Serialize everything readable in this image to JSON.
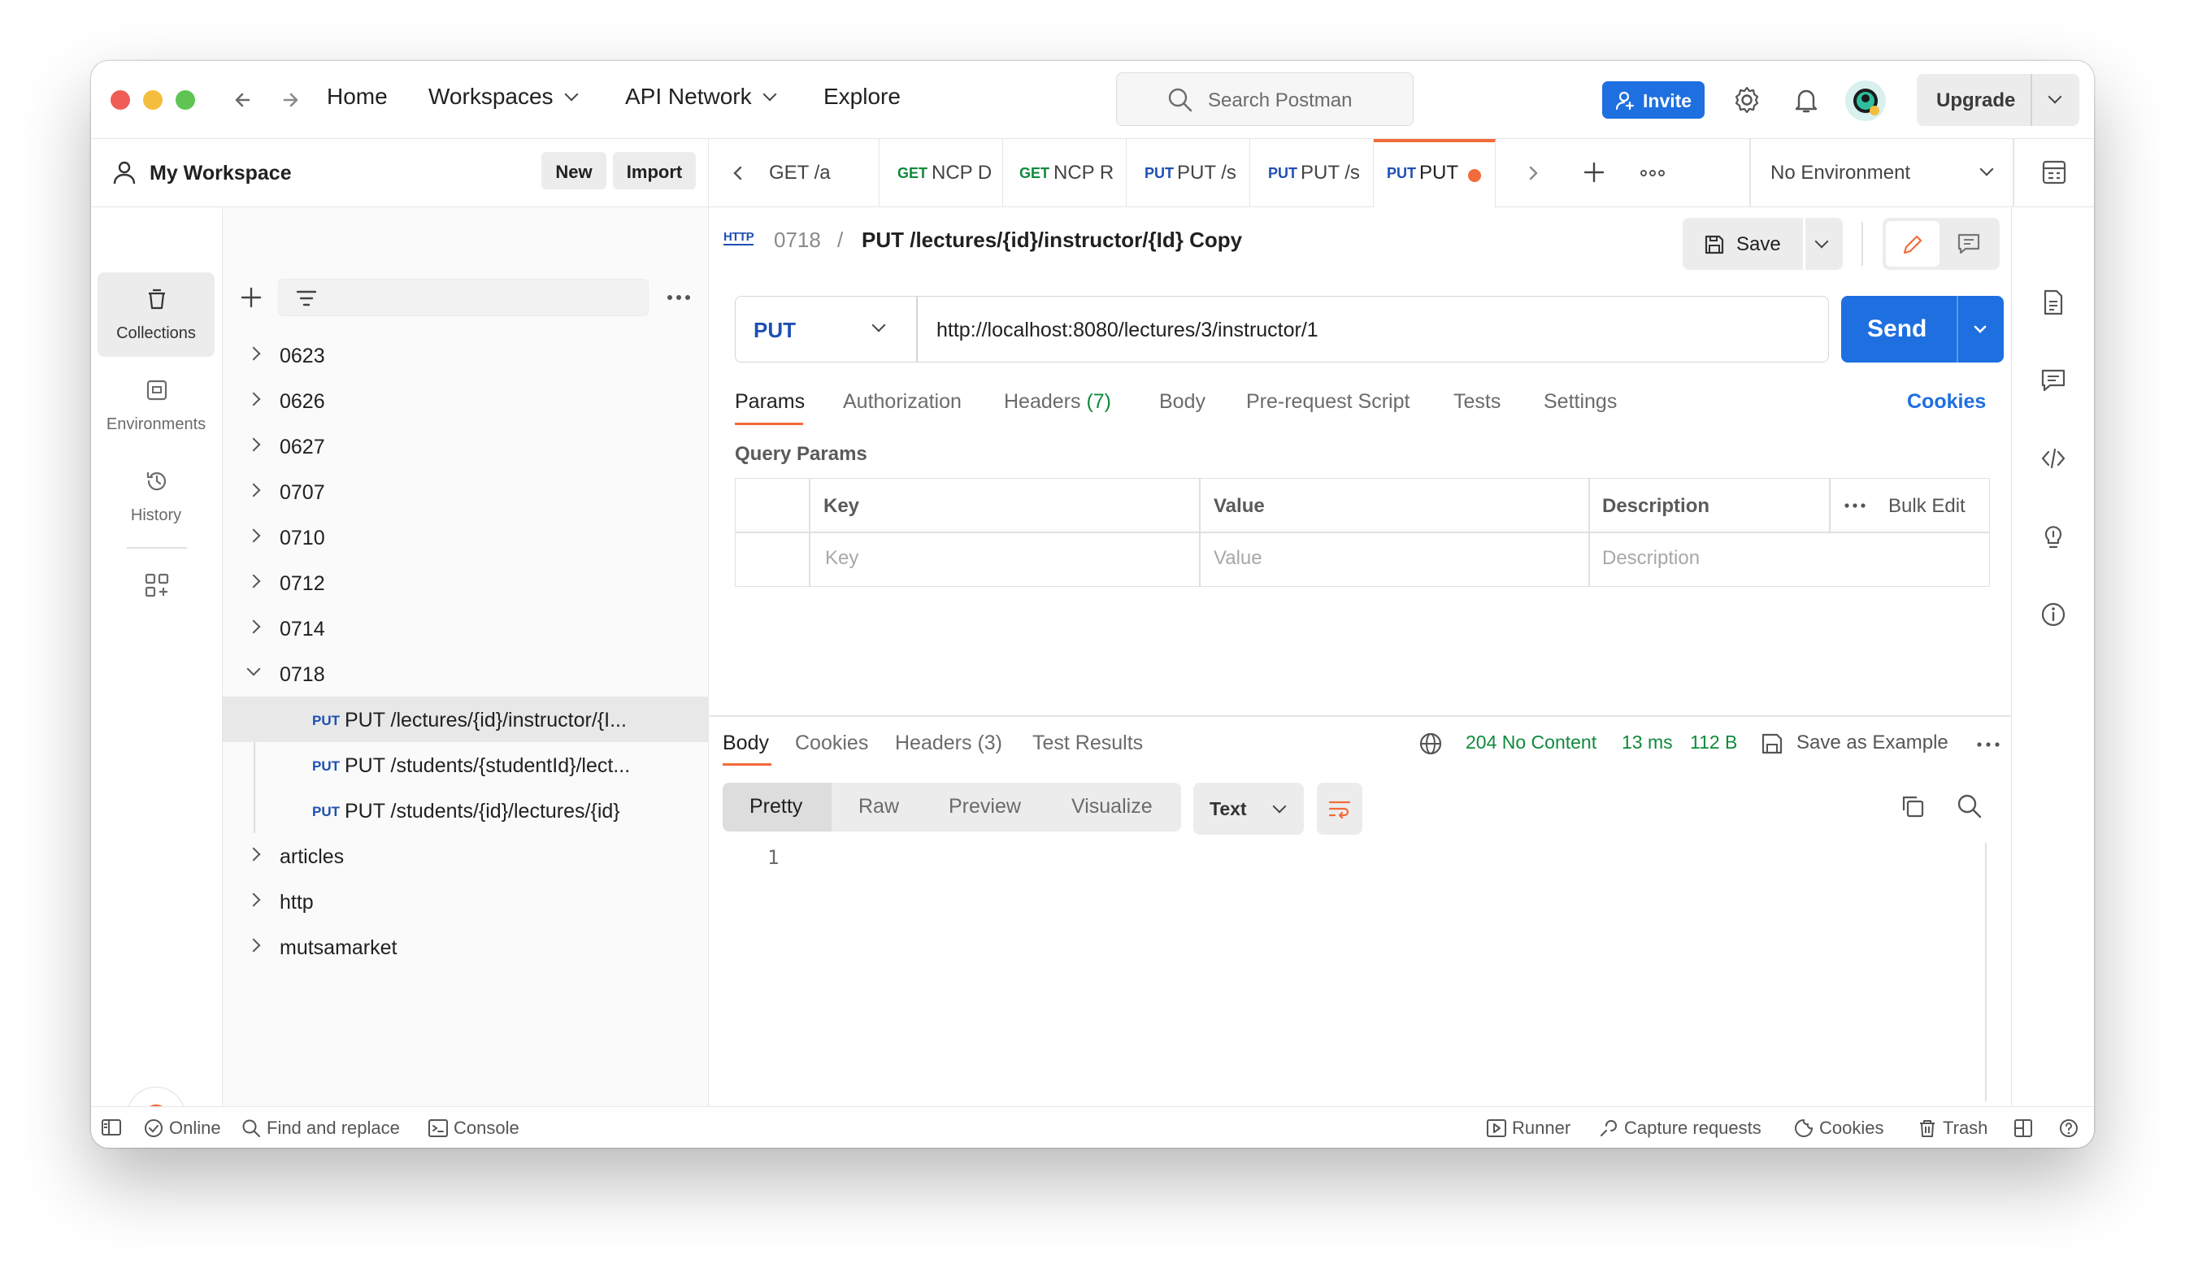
{
  "titlebar": {
    "nav": [
      "Home",
      "Workspaces",
      "API Network",
      "Explore"
    ],
    "search_placeholder": "Search Postman",
    "invite_label": "Invite",
    "upgrade_label": "Upgrade",
    "colors": {
      "close": "#ee5e56",
      "minimize": "#f5bd3c",
      "zoom": "#5fc454",
      "accent": "#1e6fe0",
      "brand": "#f26b3a"
    }
  },
  "sidebar": {
    "workspace_name": "My Workspace",
    "new_label": "New",
    "import_label": "Import",
    "rail": [
      {
        "label": "Collections",
        "icon": "collections-icon"
      },
      {
        "label": "Environments",
        "icon": "environments-icon"
      },
      {
        "label": "History",
        "icon": "history-icon"
      }
    ],
    "tree": [
      {
        "name": "0623"
      },
      {
        "name": "0626"
      },
      {
        "name": "0627"
      },
      {
        "name": "0707"
      },
      {
        "name": "0710"
      },
      {
        "name": "0712"
      },
      {
        "name": "0714"
      },
      {
        "name": "0718"
      }
    ],
    "requests": [
      {
        "method": "PUT",
        "name": "PUT /lectures/{id}/instructor/{I..."
      },
      {
        "method": "PUT",
        "name": "PUT /students/{studentId}/lect..."
      },
      {
        "method": "PUT",
        "name": "PUT /students/{id}/lectures/{id}"
      }
    ],
    "more_folders": [
      {
        "name": "articles"
      },
      {
        "name": "http"
      },
      {
        "name": "mutsamarket"
      }
    ]
  },
  "tabs": [
    {
      "method": "",
      "title": "GET /a"
    },
    {
      "method": "GET",
      "title": "NCP D"
    },
    {
      "method": "GET",
      "title": "NCP R"
    },
    {
      "method": "PUT",
      "title": "PUT /s"
    },
    {
      "method": "PUT",
      "title": "PUT /s"
    },
    {
      "method": "PUT",
      "title": "PUT"
    }
  ],
  "environment": "No Environment",
  "request": {
    "http_badge": "HTTP",
    "folder": "0718",
    "separator": "/",
    "name": "PUT /lectures/{id}/instructor/{Id} Copy",
    "save_label": "Save",
    "method": "PUT",
    "url": "http://localhost:8080/lectures/3/instructor/1",
    "send_label": "Send",
    "tabs": [
      "Params",
      "Authorization",
      "Headers",
      "Body",
      "Pre-request Script",
      "Tests",
      "Settings"
    ],
    "headers_count": "(7)",
    "cookies_label": "Cookies",
    "query_params_title": "Query Params",
    "columns": [
      "Key",
      "Value",
      "Description"
    ],
    "bulk_edit": "Bulk Edit",
    "placeholders": [
      "Key",
      "Value",
      "Description"
    ]
  },
  "response": {
    "tabs": [
      "Body",
      "Cookies",
      "Headers",
      "Test Results"
    ],
    "headers_count": "(3)",
    "status": "204 No Content",
    "time": "13 ms",
    "size": "112 B",
    "save_example": "Save as Example",
    "views": [
      "Pretty",
      "Raw",
      "Preview",
      "Visualize"
    ],
    "format": "Text",
    "line_number": "1"
  },
  "statusbar": {
    "left": [
      "Online",
      "Find and replace",
      "Console"
    ],
    "right": [
      "Runner",
      "Capture requests",
      "Cookies",
      "Trash"
    ]
  }
}
